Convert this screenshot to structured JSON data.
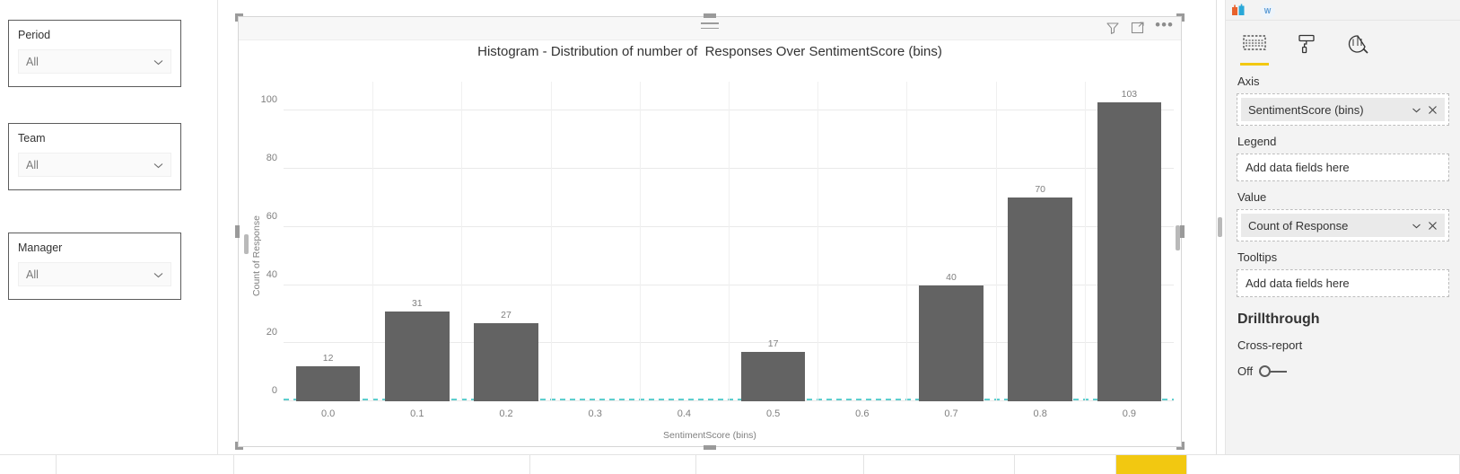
{
  "slicers": [
    {
      "title": "Period",
      "value": "All",
      "icon": "chevron-down-icon"
    },
    {
      "title": "Team",
      "value": "All",
      "icon": "chevron-down-icon"
    },
    {
      "title": "Manager",
      "value": "All",
      "icon": "chevron-down-icon"
    }
  ],
  "visual": {
    "header_icons": [
      "filter-icon",
      "focus-mode-icon",
      "more-options-icon"
    ],
    "more_options_label": "•••",
    "drag_handle": "drag-handle-icon"
  },
  "chart_data": {
    "type": "bar",
    "title": "Histogram - Distribution of number of  Responses Over SentimentScore (bins)",
    "xlabel": "SentimentScore (bins)",
    "ylabel": "Count of Response",
    "categories": [
      "0.0",
      "0.1",
      "0.2",
      "0.3",
      "0.4",
      "0.5",
      "0.6",
      "0.7",
      "0.8",
      "0.9"
    ],
    "values": [
      12,
      31,
      27,
      0,
      0,
      17,
      0,
      40,
      70,
      103
    ],
    "bar_labels": [
      "12",
      "31",
      "27",
      "",
      "",
      "17",
      "",
      "40",
      "70",
      "103"
    ],
    "yticks": [
      0,
      20,
      40,
      60,
      80,
      100
    ],
    "ytick_labels": [
      "0",
      "20",
      "40",
      "60",
      "80",
      "100"
    ],
    "ylim": [
      0,
      110
    ],
    "grid": true,
    "legend": "none",
    "bar_color": "#636363",
    "zero_line_color": "#5ECECE",
    "label_color": "#7F7F7F"
  },
  "fields_pane": {
    "top_icons": [
      "power-bi-logo-icon",
      "word-badge-icon"
    ],
    "word_badge_text": "W",
    "tabs": [
      {
        "name": "fields-tab",
        "icon": "fields-icon",
        "active": true
      },
      {
        "name": "format-tab",
        "icon": "paint-roller-icon",
        "active": false
      },
      {
        "name": "analytics-tab",
        "icon": "analytics-magnifier-icon",
        "active": false
      }
    ],
    "wells": [
      {
        "label": "Axis",
        "chip": "SentimentScore (bins)",
        "placeholder": ""
      },
      {
        "label": "Legend",
        "chip": "",
        "placeholder": "Add data fields here"
      },
      {
        "label": "Value",
        "chip": "Count of Response",
        "placeholder": ""
      },
      {
        "label": "Tooltips",
        "chip": "",
        "placeholder": "Add data fields here"
      }
    ],
    "drillthrough": {
      "heading": "Drillthrough",
      "subheading": "Cross-report",
      "toggle_label": "Off",
      "toggle_state": "off"
    }
  },
  "colors": {
    "accent_yellow": "#F2C811",
    "bar_gray": "#636363",
    "cyan": "#5ECECE"
  }
}
